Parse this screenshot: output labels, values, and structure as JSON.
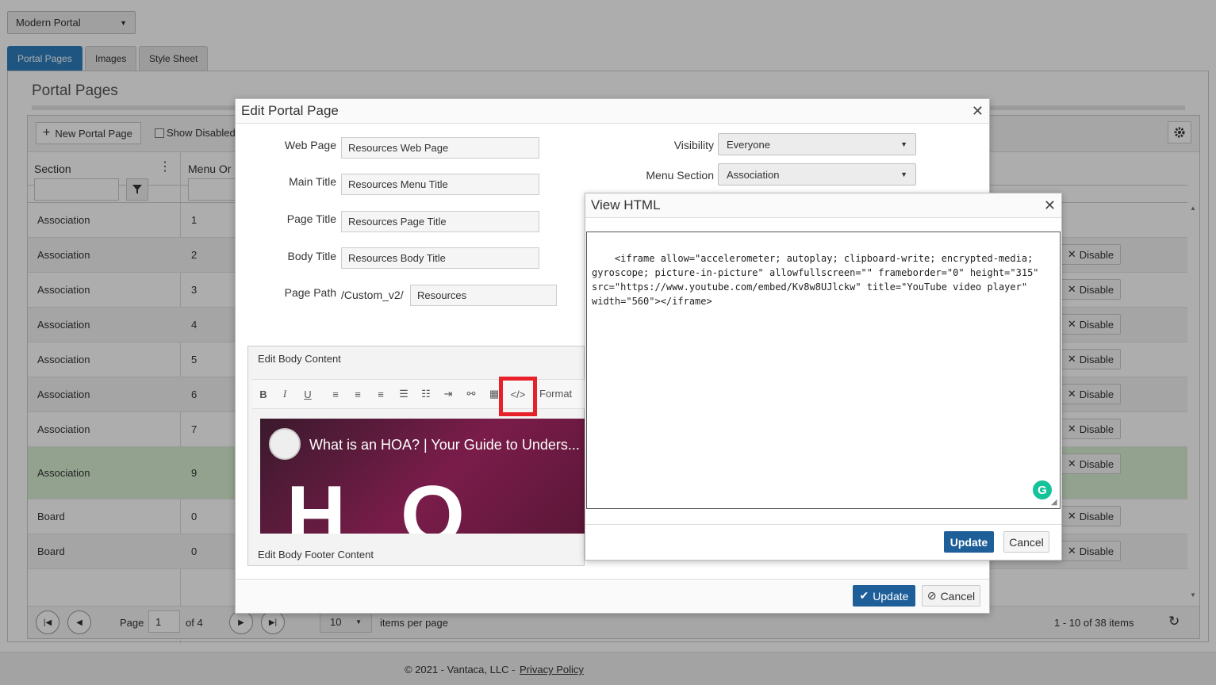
{
  "portal_select": {
    "value": "Modern Portal"
  },
  "tabs": [
    {
      "label": "Portal Pages"
    },
    {
      "label": "Images"
    },
    {
      "label": "Style Sheet"
    }
  ],
  "page_heading": "Portal Pages",
  "toolbar": {
    "new_label": "New Portal Page",
    "show_disabled_label": "Show Disabled"
  },
  "columns": {
    "section": "Section",
    "menu_order": "Menu Or"
  },
  "rows": [
    {
      "section": "Association",
      "order": "1",
      "action": ""
    },
    {
      "section": "Association",
      "order": "2",
      "action": "Disable"
    },
    {
      "section": "Association",
      "order": "3",
      "action": "Disable"
    },
    {
      "section": "Association",
      "order": "4",
      "action": "Disable"
    },
    {
      "section": "Association",
      "order": "5",
      "action": "Disable"
    },
    {
      "section": "Association",
      "order": "6",
      "action": "Disable"
    },
    {
      "section": "Association",
      "order": "7",
      "action": "Disable"
    },
    {
      "section": "Association",
      "order": "9",
      "action": "Disable"
    },
    {
      "section": "Board",
      "order": "0",
      "action": "Disable"
    },
    {
      "section": "Board",
      "order": "0",
      "action": "Disable"
    }
  ],
  "pager": {
    "page_label": "Page",
    "page_value": "1",
    "of_label": "of 4",
    "per_page_value": "10",
    "per_page_label": "items per page",
    "summary": "1 - 10 of 38 items"
  },
  "footer": {
    "copyright": "© 2021 - Vantaca, LLC -",
    "privacy": "Privacy Policy"
  },
  "edit_dialog": {
    "title": "Edit Portal Page",
    "web_page_label": "Web Page",
    "web_page_value": "Resources Web Page",
    "main_title_label": "Main Title",
    "main_title_value": "Resources Menu Title",
    "page_title_label": "Page Title",
    "page_title_value": "Resources Page Title",
    "body_title_label": "Body Title",
    "body_title_value": "Resources Body Title",
    "page_path_label": "Page Path",
    "page_path_prefix": "/Custom_v2/",
    "page_path_value": "Resources",
    "visibility_label": "Visibility",
    "visibility_value": "Everyone",
    "menu_section_label": "Menu Section",
    "menu_section_value": "Association",
    "body_content_label": "Edit Body Content",
    "footer_content_label": "Edit Body Footer Content",
    "format_label": "Format",
    "video_title": "What is an HOA? | Your Guide to Unders...",
    "video_overlay_text": "H O",
    "update_label": "Update",
    "cancel_label": "Cancel"
  },
  "html_dialog": {
    "title": "View HTML",
    "code": "<iframe allow=\"accelerometer; autoplay; clipboard-write; encrypted-media; gyroscope; picture-in-picture\" allowfullscreen=\"\" frameborder=\"0\" height=\"315\" src=\"https://www.youtube.com/embed/Kv8w8UJlckw\" title=\"YouTube video player\" width=\"560\"></iframe>",
    "update_label": "Update",
    "cancel_label": "Cancel"
  },
  "colors": {
    "accent": "#2e7fbf",
    "primary_button": "#1f5f99",
    "highlight": "#e8202a",
    "selected_row": "#d9efd3",
    "grammarly": "#15c39a"
  }
}
